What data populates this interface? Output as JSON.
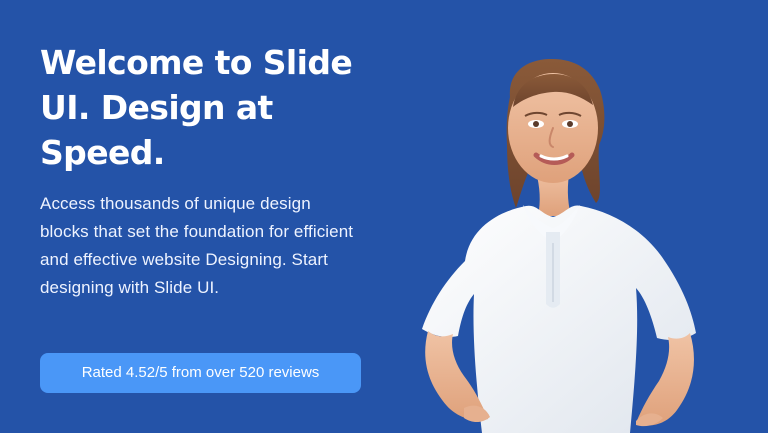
{
  "hero": {
    "headline": "Welcome to Slide UI. Design at Speed.",
    "description": "Access thousands of unique design blocks that set the foundation for efficient and effective website Designing. Start designing with Slide UI.",
    "cta_label": "Rated 4.52/5 from over 520 reviews"
  },
  "colors": {
    "background": "#2453a8",
    "button": "#4a97f7",
    "text": "#ffffff"
  }
}
